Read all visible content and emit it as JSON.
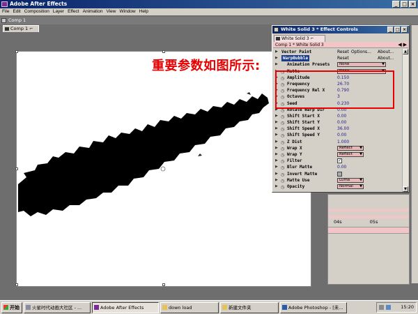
{
  "app": {
    "title": "Adobe After Effects",
    "window_buttons": [
      "_",
      "□",
      "×"
    ]
  },
  "menu": [
    "File",
    "Edit",
    "Composition",
    "Layer",
    "Effect",
    "Animation",
    "View",
    "Window",
    "Help"
  ],
  "comp_window": {
    "title": "Comp 1",
    "tab": "Comp 1 ⌐"
  },
  "annotation": {
    "text": "重要参数如图所示:",
    "color": "#e60000"
  },
  "effect_controls": {
    "title": "White Solid 3 * Effect Controls",
    "tab": "White Solid 3 ⌐",
    "path": "Comp 1 * White Solid 3",
    "rows": [
      {
        "type": "effect",
        "label": "Vector Paint",
        "reset": "Reset",
        "options": "Options...",
        "about": "About..."
      },
      {
        "type": "effect",
        "label": "WarpBubble",
        "reset": "Reset",
        "about": "About...",
        "selected": true
      },
      {
        "type": "dropdown",
        "label": "Animation Presets",
        "value": "None"
      },
      {
        "type": "dropdown",
        "label": "Matte",
        "value": "None"
      },
      {
        "type": "value",
        "label": "Amplitude",
        "value": "0.150"
      },
      {
        "type": "value",
        "label": "Frequency",
        "value": "26.70"
      },
      {
        "type": "value",
        "label": "Frequency Rel X",
        "value": "0.790"
      },
      {
        "type": "value",
        "label": "Octaves",
        "value": "3"
      },
      {
        "type": "value",
        "label": "Seed",
        "value": "0.230"
      },
      {
        "type": "value",
        "label": "Rotate Warp Dir",
        "value": "0.00"
      },
      {
        "type": "value",
        "label": "Shift Start X",
        "value": "0.00"
      },
      {
        "type": "value",
        "label": "Shift Start Y",
        "value": "0.00"
      },
      {
        "type": "value",
        "label": "Shift Speed X",
        "value": "36.00"
      },
      {
        "type": "value",
        "label": "Shift Speed Y",
        "value": "0.00"
      },
      {
        "type": "value",
        "label": "Z Dist",
        "value": "1.000"
      },
      {
        "type": "dropdown",
        "label": "Wrap X",
        "value": "Reflect"
      },
      {
        "type": "dropdown",
        "label": "Wrap Y",
        "value": "Reflect"
      },
      {
        "type": "checkbox",
        "label": "Filter",
        "checked": true
      },
      {
        "type": "value",
        "label": "Blur Matte",
        "value": "0.00"
      },
      {
        "type": "checkbox",
        "label": "Invert Matte",
        "checked": false
      },
      {
        "type": "dropdown",
        "label": "Matte Use",
        "value": "Luma"
      },
      {
        "type": "dropdown",
        "label": "Opacity",
        "value": "Normal"
      }
    ]
  },
  "timeline": {
    "times": [
      "04s",
      "05s"
    ]
  },
  "taskbar": {
    "start": "开始",
    "tasks": [
      {
        "label": "火星时代动画大社区 - ...",
        "active": false
      },
      {
        "label": "Adobe After Effects",
        "active": true
      },
      {
        "label": "down load",
        "active": false
      },
      {
        "label": "新建文件夹",
        "active": false
      },
      {
        "label": "Adobe Photoshop - [未...",
        "active": false
      }
    ],
    "clock": "15:20"
  }
}
